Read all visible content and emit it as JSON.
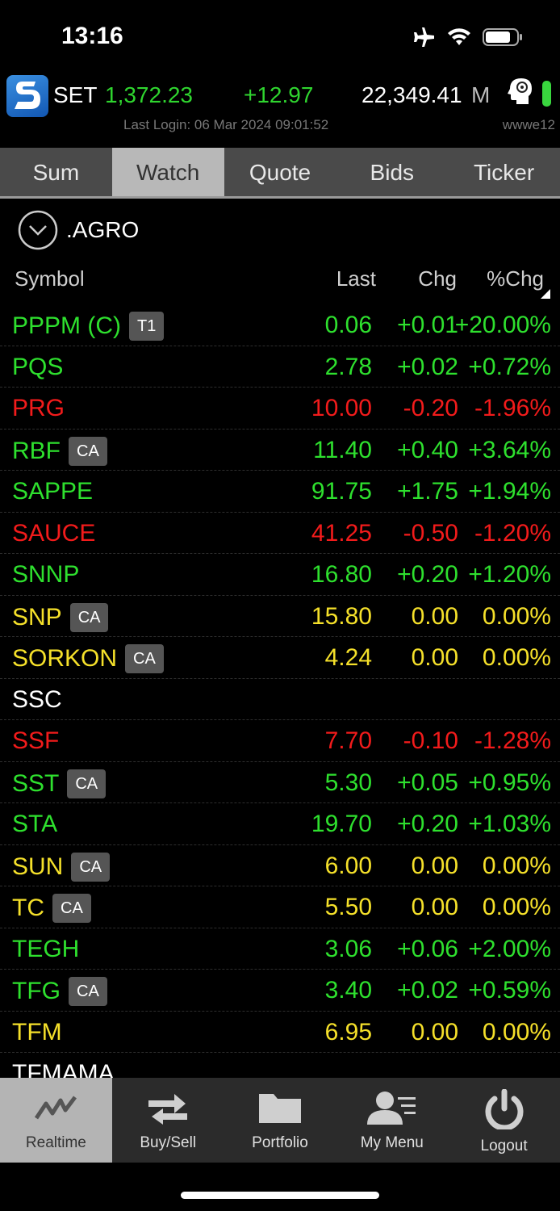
{
  "status_bar": {
    "time": "13:16"
  },
  "header": {
    "index_name": "SET",
    "index_value": "1,372.23",
    "index_change": "+12.97",
    "volume": "22,349.41",
    "volume_unit": "M",
    "last_login": "Last Login: 06 Mar 2024 09:01:52",
    "username": "wwwe12"
  },
  "tabs": [
    {
      "label": "Sum",
      "active": false
    },
    {
      "label": "Watch",
      "active": true
    },
    {
      "label": "Quote",
      "active": false
    },
    {
      "label": "Bids",
      "active": false
    },
    {
      "label": "Ticker",
      "active": false
    }
  ],
  "group": {
    "name": ".AGRO"
  },
  "columns": {
    "symbol": "Symbol",
    "last": "Last",
    "chg": "Chg",
    "pct": "%Chg"
  },
  "colors": {
    "up": "#2ee02e",
    "down": "#f21b1b",
    "flat": "#f5e02a",
    "none": "#ffffff"
  },
  "rows": [
    {
      "symbol": "PPPM (C)",
      "badge": "T1",
      "last": "0.06",
      "chg": "+0.01",
      "pct": "+20.00%",
      "dir": "up"
    },
    {
      "symbol": "PQS",
      "badge": "",
      "last": "2.78",
      "chg": "+0.02",
      "pct": "+0.72%",
      "dir": "up"
    },
    {
      "symbol": "PRG",
      "badge": "",
      "last": "10.00",
      "chg": "-0.20",
      "pct": "-1.96%",
      "dir": "down"
    },
    {
      "symbol": "RBF",
      "badge": "CA",
      "last": "11.40",
      "chg": "+0.40",
      "pct": "+3.64%",
      "dir": "up"
    },
    {
      "symbol": "SAPPE",
      "badge": "",
      "last": "91.75",
      "chg": "+1.75",
      "pct": "+1.94%",
      "dir": "up"
    },
    {
      "symbol": "SAUCE",
      "badge": "",
      "last": "41.25",
      "chg": "-0.50",
      "pct": "-1.20%",
      "dir": "down"
    },
    {
      "symbol": "SNNP",
      "badge": "",
      "last": "16.80",
      "chg": "+0.20",
      "pct": "+1.20%",
      "dir": "up"
    },
    {
      "symbol": "SNP",
      "badge": "CA",
      "last": "15.80",
      "chg": "0.00",
      "pct": "0.00%",
      "dir": "flat"
    },
    {
      "symbol": "SORKON",
      "badge": "CA",
      "last": "4.24",
      "chg": "0.00",
      "pct": "0.00%",
      "dir": "flat"
    },
    {
      "symbol": "SSC",
      "badge": "",
      "last": "",
      "chg": "",
      "pct": "",
      "dir": "none"
    },
    {
      "symbol": "SSF",
      "badge": "",
      "last": "7.70",
      "chg": "-0.10",
      "pct": "-1.28%",
      "dir": "down"
    },
    {
      "symbol": "SST",
      "badge": "CA",
      "last": "5.30",
      "chg": "+0.05",
      "pct": "+0.95%",
      "dir": "up"
    },
    {
      "symbol": "STA",
      "badge": "",
      "last": "19.70",
      "chg": "+0.20",
      "pct": "+1.03%",
      "dir": "up"
    },
    {
      "symbol": "SUN",
      "badge": "CA",
      "last": "6.00",
      "chg": "0.00",
      "pct": "0.00%",
      "dir": "flat"
    },
    {
      "symbol": "TC",
      "badge": "CA",
      "last": "5.50",
      "chg": "0.00",
      "pct": "0.00%",
      "dir": "flat"
    },
    {
      "symbol": "TEGH",
      "badge": "",
      "last": "3.06",
      "chg": "+0.06",
      "pct": "+2.00%",
      "dir": "up"
    },
    {
      "symbol": "TFG",
      "badge": "CA",
      "last": "3.40",
      "chg": "+0.02",
      "pct": "+0.59%",
      "dir": "up"
    },
    {
      "symbol": "TFM",
      "badge": "",
      "last": "6.95",
      "chg": "0.00",
      "pct": "0.00%",
      "dir": "flat"
    },
    {
      "symbol": "TFMAMA",
      "badge": "",
      "last": "",
      "chg": "",
      "pct": "",
      "dir": "none"
    }
  ],
  "tabbar": [
    {
      "label": "Realtime",
      "icon": "chart-line-icon",
      "active": true
    },
    {
      "label": "Buy/Sell",
      "icon": "swap-arrows-icon",
      "active": false
    },
    {
      "label": "Portfolio",
      "icon": "folder-icon",
      "active": false
    },
    {
      "label": "My Menu",
      "icon": "user-list-icon",
      "active": false
    },
    {
      "label": "Logout",
      "icon": "power-icon",
      "active": false
    }
  ]
}
